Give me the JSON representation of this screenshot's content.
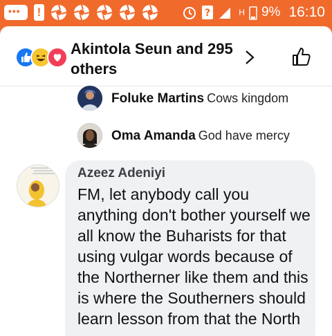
{
  "status_bar": {
    "battery": "9%",
    "time": "16:10",
    "network": "H"
  },
  "reactions": {
    "text": "Akintola Seun and 295 others"
  },
  "replies": [
    {
      "name": "Foluke Martins",
      "text": "Cows kingdom"
    },
    {
      "name": "Oma Amanda",
      "text": "God have mercy"
    }
  ],
  "comment": {
    "author": "Azeez Adeniyi",
    "text": "FM, let anybody call you anything don't bother yourself we all know the Buharists for that using vulgar words because of the Northerner like them and this is where the Southerners should learn lesson from that the North"
  },
  "colors": {
    "status_bar": "#f06a2c",
    "bubble": "#eff1f3",
    "like_blue": "#1877f2"
  }
}
